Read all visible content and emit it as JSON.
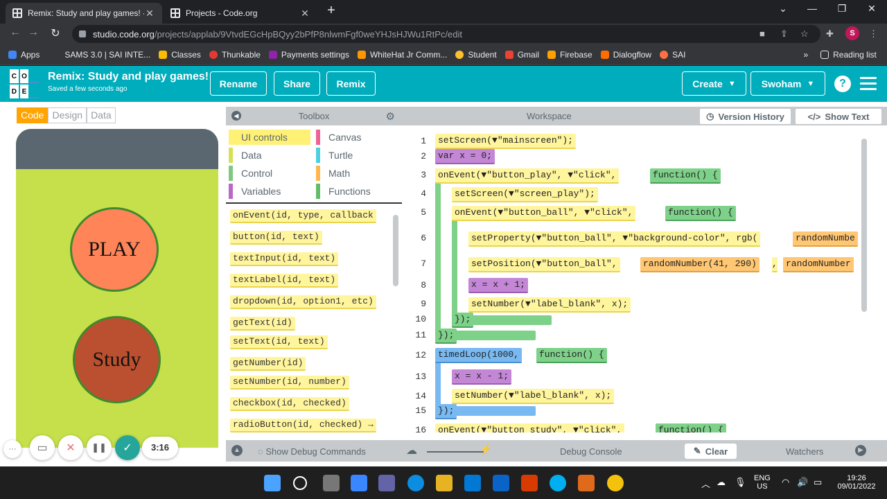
{
  "browser": {
    "tabs": [
      {
        "title": "Remix: Study and play games! - A"
      },
      {
        "title": "Projects - Code.org"
      }
    ],
    "new_tab": "+",
    "close_glyph": "✕",
    "window_controls": [
      "⌄",
      "—",
      "❐",
      "✕"
    ],
    "url_host": "studio.code.org",
    "url_path": "/projects/applab/9VtvdEGcHpBQyy2bPfP8nlwmFgf0weYHJsHJWu1RtPc/edit",
    "profile_initial": "S",
    "bookmarks": [
      {
        "label": "Apps",
        "color": "#fbbc04"
      },
      {
        "label": "SAMS 3.0 | SAI INTE...",
        "color": ""
      },
      {
        "label": "Classes",
        "color": "#fbbc04"
      },
      {
        "label": "Thunkable",
        "color": "#e53935"
      },
      {
        "label": "Payments settings",
        "color": "#8e24aa"
      },
      {
        "label": "WhiteHat Jr Comm...",
        "color": "#ff9800"
      },
      {
        "label": "Student",
        "color": "#fbc02d"
      },
      {
        "label": "Gmail",
        "color": "#ea4335"
      },
      {
        "label": "Firebase",
        "color": "#ffa000"
      },
      {
        "label": "Dialogflow",
        "color": "#ff6d00"
      },
      {
        "label": "SAI",
        "color": "#ff7043"
      }
    ],
    "bookmarks_more": "»",
    "reading_list": "Reading list"
  },
  "header": {
    "logo_letters": [
      "C",
      "O",
      "D",
      "E"
    ],
    "project_title": "Remix: Study and play games!",
    "saved_status": "Saved a few seconds ago",
    "buttons": {
      "rename": "Rename",
      "share": "Share",
      "remix": "Remix",
      "create": "Create",
      "user": "Swoham"
    },
    "help": "?"
  },
  "left": {
    "modes": [
      "Code",
      "Design",
      "Data"
    ],
    "app": {
      "play_label": "PLAY",
      "study_label": "Study"
    }
  },
  "recorder": {
    "timer": "3:16",
    "more": "···",
    "close": "✕",
    "pause": "❚❚",
    "done": "✓",
    "camera": "▭"
  },
  "toolbox": {
    "title": "Toolbox",
    "categories": [
      {
        "label": "UI controls",
        "color": "#fff176"
      },
      {
        "label": "Canvas",
        "color": "#f06292"
      },
      {
        "label": "Data",
        "color": "#d4e157"
      },
      {
        "label": "Turtle",
        "color": "#4dd0e1"
      },
      {
        "label": "Control",
        "color": "#81c784"
      },
      {
        "label": "Math",
        "color": "#ffb74d"
      },
      {
        "label": "Variables",
        "color": "#ba68c8"
      },
      {
        "label": "Functions",
        "color": "#66bb6a"
      }
    ],
    "blocks": [
      "onEvent(id, type, callback",
      "button(id, text)",
      "textInput(id, text)",
      "textLabel(id, text)",
      "dropdown(id, option1, etc)",
      "getText(id)",
      "setText(id, text)",
      "getNumber(id)",
      "setNumber(id, number)",
      "checkbox(id, checked)",
      "radioButton(id, checked) →"
    ]
  },
  "workspace": {
    "title": "Workspace",
    "version_history": "Version History",
    "show_text": "Show Text",
    "line_numbers": [
      "1",
      "2",
      "3",
      "4",
      "5",
      "6",
      "7",
      "8",
      "9",
      "10",
      "11",
      "12",
      "13",
      "14",
      "15",
      "16"
    ],
    "code": {
      "l1": "setScreen(▼\"mainscreen\");",
      "l2": "var x = 0;",
      "l3a": "onEvent(▼\"button_play\", ▼\"click\",",
      "l3b": "function() {",
      "l4": "setScreen(▼\"screen_play\");",
      "l5a": "onEvent(▼\"button_ball\", ▼\"click\",",
      "l5b": "function() {",
      "l6a": "setProperty(▼\"button_ball\", ▼\"background-color\", rgb(",
      "l6b": "randomNumbe",
      "l7a": "setPosition(▼\"button_ball\",",
      "l7b": "randomNumber(41, 290)",
      "l7c": ", ",
      "l7d": "randomNumber",
      "l8": "x = x + 1;",
      "l9": "setNumber(▼\"label_blank\", x);",
      "l10": "});",
      "l11": "});",
      "l12a": "timedLoop(1000,",
      "l12b": "function() {",
      "l13": "x = x - 1;",
      "l14": "setNumber(▼\"label_blank\", x);",
      "l15": "});",
      "l16a": "onEvent(▼\"button_study\", ▼\"click\",",
      "l16b": "function() {"
    }
  },
  "debug": {
    "show_commands": "Show Debug Commands",
    "console": "Debug Console",
    "clear": "Clear",
    "watchers": "Watchers"
  },
  "taskbar": {
    "language": "ENG",
    "region": "US",
    "time": "19:26",
    "date": "09/01/2022"
  }
}
